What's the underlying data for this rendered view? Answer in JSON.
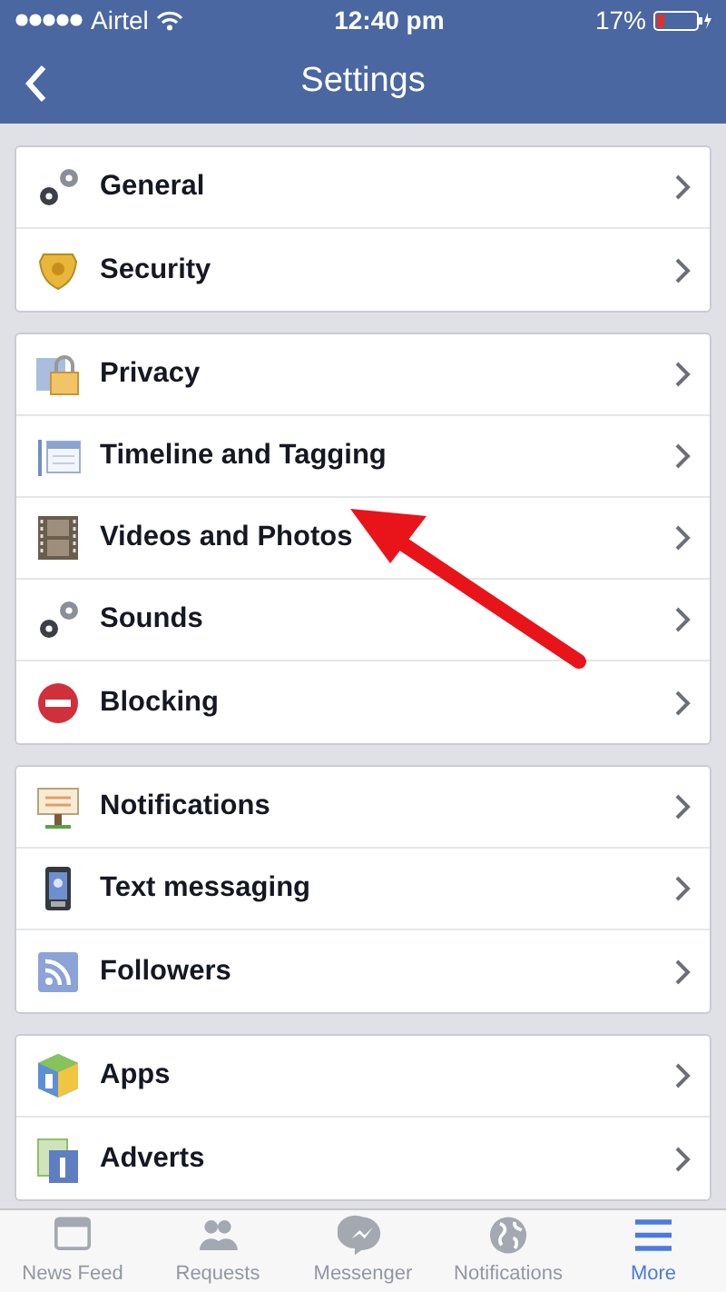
{
  "status_bar": {
    "carrier": "Airtel",
    "time": "12:40 pm",
    "battery": "17%"
  },
  "nav": {
    "title": "Settings"
  },
  "sections": [
    {
      "items": [
        {
          "label": "General",
          "kind": "gears"
        },
        {
          "label": "Security",
          "kind": "shield"
        }
      ]
    },
    {
      "items": [
        {
          "label": "Privacy",
          "kind": "lock"
        },
        {
          "label": "Timeline and Tagging",
          "kind": "timeline"
        },
        {
          "label": "Videos and Photos",
          "kind": "film"
        },
        {
          "label": "Sounds",
          "kind": "gears"
        },
        {
          "label": "Blocking",
          "kind": "block"
        }
      ]
    },
    {
      "items": [
        {
          "label": "Notifications",
          "kind": "sign"
        },
        {
          "label": "Text messaging",
          "kind": "phone"
        },
        {
          "label": "Followers",
          "kind": "rss"
        }
      ]
    },
    {
      "items": [
        {
          "label": "Apps",
          "kind": "cube"
        },
        {
          "label": "Adverts",
          "kind": "advert"
        }
      ]
    }
  ],
  "tab_bar": [
    {
      "label": "News Feed",
      "kind": "feed",
      "selected": false
    },
    {
      "label": "Requests",
      "kind": "people",
      "selected": false
    },
    {
      "label": "Messenger",
      "kind": "messenger",
      "selected": false
    },
    {
      "label": "Notifications",
      "kind": "globe",
      "selected": false
    },
    {
      "label": "More",
      "kind": "menu",
      "selected": true
    }
  ]
}
